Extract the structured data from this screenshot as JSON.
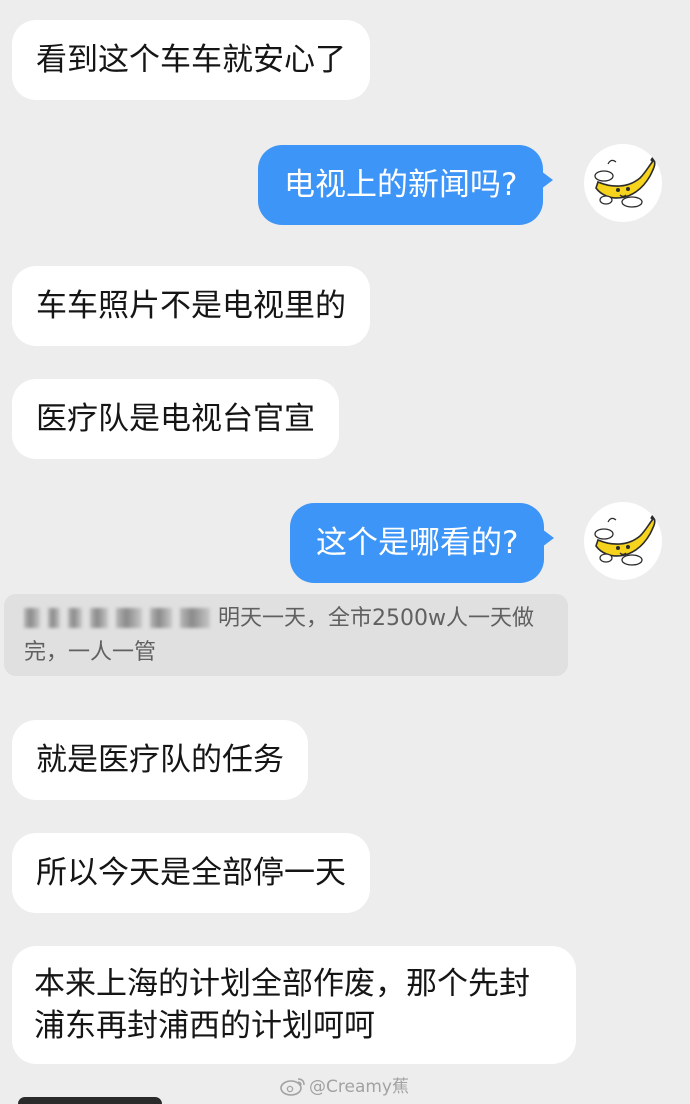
{
  "messages": [
    {
      "side": "in",
      "text": "看到这个车车就安心了"
    },
    {
      "side": "out",
      "text": "电视上的新闻吗?"
    },
    {
      "side": "in",
      "text": "车车照片不是电视里的"
    },
    {
      "side": "in",
      "text": "医疗队是电视台官宣"
    },
    {
      "side": "out",
      "text": "这个是哪看的?"
    },
    {
      "side": "in",
      "text": "就是医疗队的任务"
    },
    {
      "side": "in",
      "text": "所以今天是全部停一天"
    },
    {
      "side": "in",
      "text": "本来上海的计划全部作废，那个先封浦东再封浦西的计划呵呵"
    }
  ],
  "quote": {
    "visible_text": "明天一天，全市2500w人一天做完，一人一管"
  },
  "watermark": {
    "text": "@Creamy蕉"
  },
  "colors": {
    "background": "#ededed",
    "incoming_bubble": "#ffffff",
    "outgoing_bubble": "#3d95f7",
    "quote_background": "#e0e0e0"
  },
  "icons": {
    "avatar": "banana-avatar-icon",
    "watermark": "weibo-icon"
  }
}
